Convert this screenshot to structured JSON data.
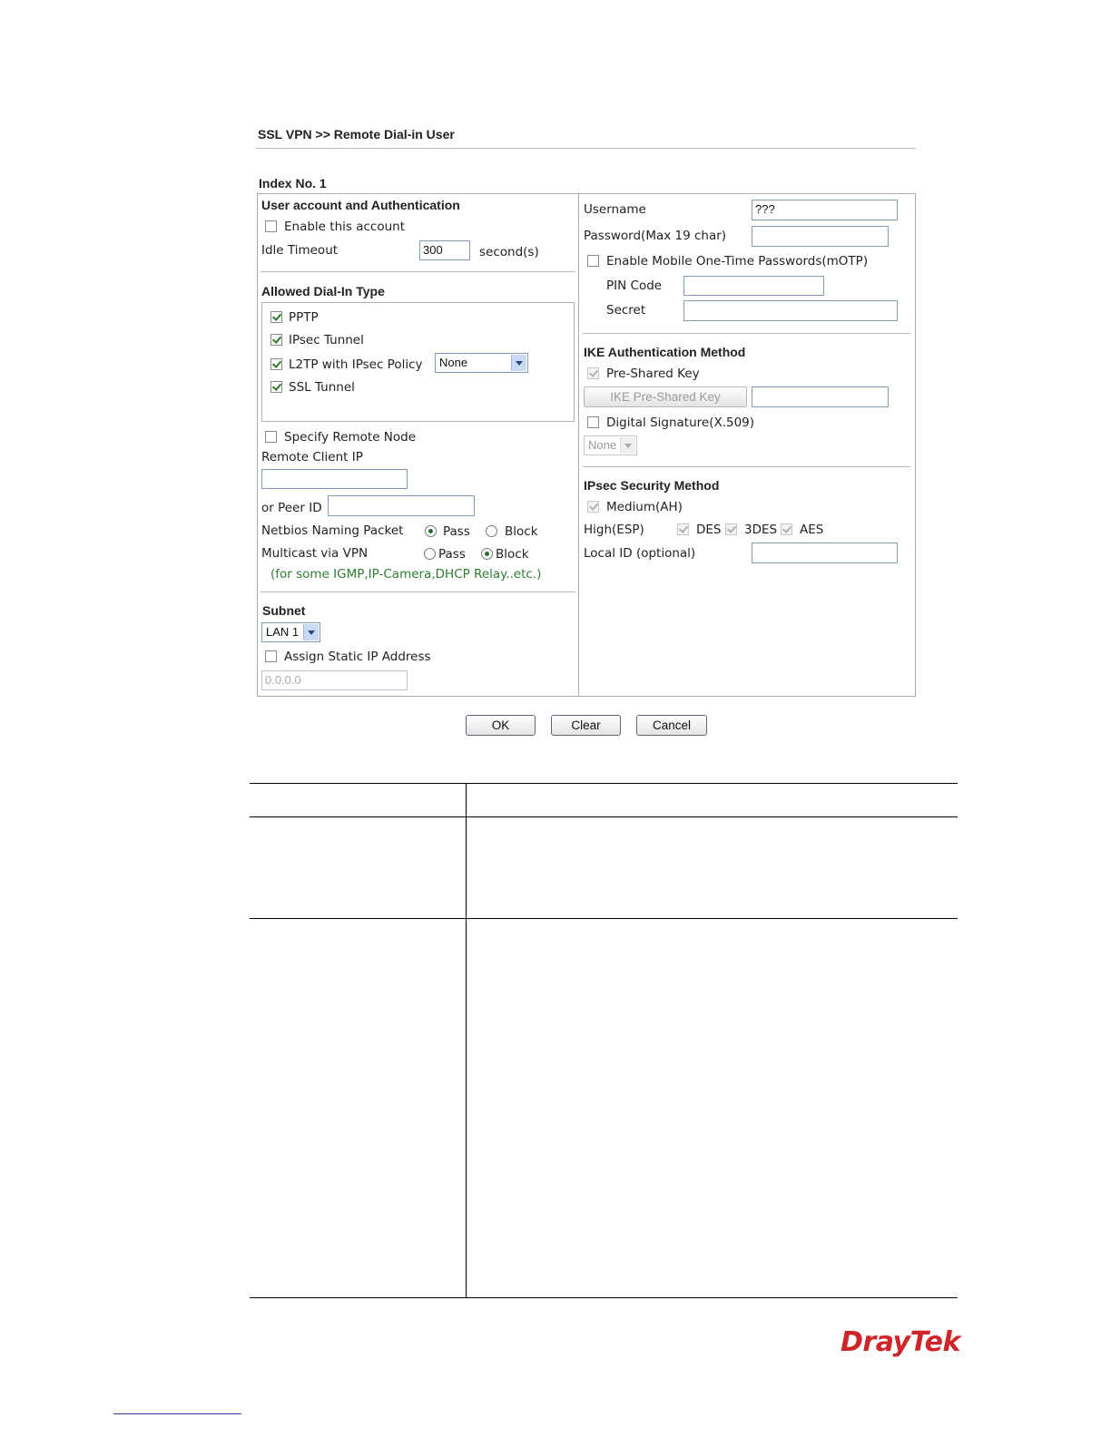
{
  "breadcrumb": "SSL VPN >> Remote Dial-in User",
  "index_label": "Index No. 1",
  "left": {
    "account_section": "User account and Authentication",
    "enable_account_label": "Enable this account",
    "idle_timeout_label": "Idle Timeout",
    "idle_timeout_value": "300",
    "idle_timeout_unit": "second(s)",
    "dialin_section": "Allowed Dial-In Type",
    "dialin_types": [
      {
        "label": "PPTP",
        "checked": true
      },
      {
        "label": "IPsec Tunnel",
        "checked": true
      },
      {
        "label": "L2TP with IPsec Policy",
        "checked": true
      },
      {
        "label": "SSL Tunnel",
        "checked": true
      }
    ],
    "l2tp_policy_value": "None",
    "specify_remote_node_label": "Specify Remote Node",
    "remote_client_ip_label": "Remote Client IP",
    "remote_client_ip_value": "",
    "peer_id_label": "or Peer ID",
    "peer_id_value": "",
    "netbios_label": "Netbios Naming Packet",
    "netbios_pass": "Pass",
    "netbios_block": "Block",
    "multicast_label": "Multicast via VPN",
    "multicast_pass": "Pass",
    "multicast_block": "Block",
    "multicast_note": "(for some IGMP,IP-Camera,DHCP Relay..etc.)",
    "subnet_section": "Subnet",
    "subnet_value": "LAN 1",
    "assign_static_label": "Assign Static IP Address",
    "static_ip_value": "0.0.0.0"
  },
  "right": {
    "username_label": "Username",
    "username_value": "???",
    "password_label": "Password(Max 19 char)",
    "password_value": "",
    "motp_label": "Enable Mobile One-Time Passwords(mOTP)",
    "pin_label": "PIN Code",
    "secret_label": "Secret",
    "ike_section": "IKE Authentication Method",
    "preshared_label": "Pre-Shared Key",
    "ike_psk_button": "IKE Pre-Shared Key",
    "digital_sig_label": "Digital Signature(X.509)",
    "digital_sig_value": "None",
    "ipsec_section": "IPsec Security Method",
    "medium_label": "Medium(AH)",
    "high_label": "High(ESP)",
    "des_label": "DES",
    "des3_label": "3DES",
    "aes_label": "AES",
    "local_id_label": "Local ID (optional)",
    "local_id_value": ""
  },
  "buttons": {
    "ok": "OK",
    "clear": "Clear",
    "cancel": "Cancel"
  },
  "brand": "DrayTek"
}
